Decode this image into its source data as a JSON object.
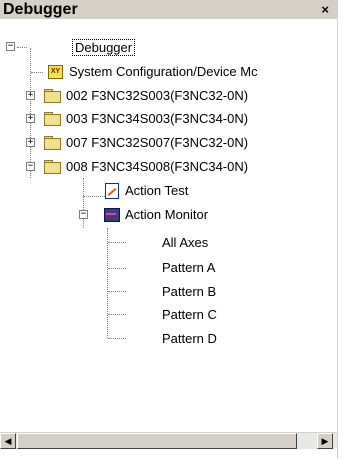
{
  "window": {
    "title": "Debugger",
    "close_glyph": "×"
  },
  "tree": {
    "root": {
      "label": "Debugger",
      "toggle": "−"
    },
    "system_config": {
      "label": "System Configuration/Device Mc",
      "icon": "system-config-icon"
    },
    "nodes": [
      {
        "label": "002 F3NC32S003(F3NC32-0N)",
        "toggle": "+"
      },
      {
        "label": "003 F3NC34S003(F3NC34-0N)",
        "toggle": "+"
      },
      {
        "label": "007 F3NC32S007(F3NC32-0N)",
        "toggle": "+"
      },
      {
        "label": "008 F3NC34S008(F3NC34-0N)",
        "toggle": "−"
      }
    ],
    "action_test": {
      "label": "Action Test"
    },
    "action_monitor": {
      "label": "Action Monitor",
      "toggle": "−"
    },
    "monitor_items": [
      {
        "label": "All Axes"
      },
      {
        "label": "Pattern A"
      },
      {
        "label": "Pattern B"
      },
      {
        "label": "Pattern C"
      },
      {
        "label": "Pattern D"
      }
    ]
  },
  "scrollbar": {
    "left_arrow": "◀",
    "right_arrow": "▶"
  }
}
